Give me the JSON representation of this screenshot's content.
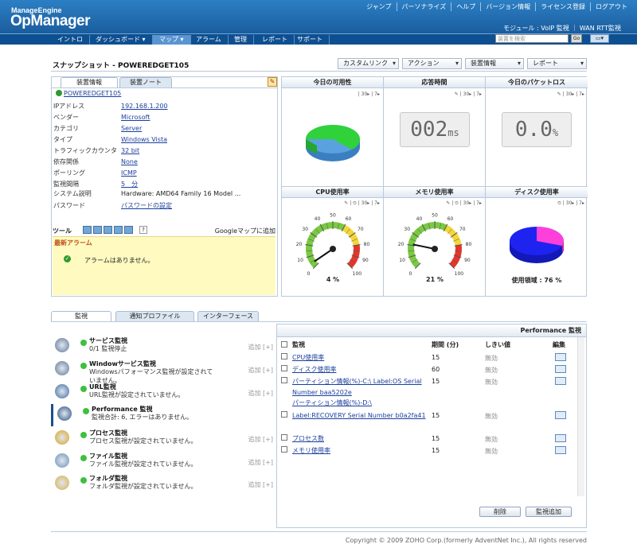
{
  "header": {
    "brand_small": "ManageEngine",
    "brand_large": "OpManager",
    "top_links": [
      "ジャンプ",
      "パーソナライズ",
      "ヘルプ",
      "バージョン情報",
      "ライセンス登録",
      "ログアウト"
    ],
    "module_line": "モジュール : VoIP 監視 ｜ WAN RTT監視",
    "search_placeholder": "装置を検索",
    "go_label": "Go"
  },
  "nav": {
    "tabs": [
      "イントロ",
      "ダッシュボード ▾",
      "マップ ▾",
      "アラーム",
      "管理",
      "レポート",
      "サポート"
    ],
    "active": "マップ ▾"
  },
  "snapshot": {
    "title": "スナップショット - POWEREDGET105",
    "dropdowns": [
      "カスタムリンク",
      "アクション",
      "装置情報",
      "レポート"
    ]
  },
  "device": {
    "tabs": [
      "装置情報",
      "装置ノート"
    ],
    "name": "POWEREDGET105",
    "props": [
      {
        "k": "IPアドレス",
        "v": "192.168.1.200",
        "link": true
      },
      {
        "k": "ベンダー",
        "v": "Microsoft",
        "link": true
      },
      {
        "k": "カテゴリ",
        "v": "Server",
        "link": true
      },
      {
        "k": "タイプ",
        "v": "Windows Vista",
        "link": true
      },
      {
        "k": "トラフィックカウンタ",
        "v": "32 bit",
        "link": true
      },
      {
        "k": "依存関係",
        "v": "None",
        "link": true
      },
      {
        "k": "ポーリング",
        "v": "ICMP",
        "link": true
      },
      {
        "k": "監視間隔",
        "v": "5　分",
        "link": true
      },
      {
        "k": "システム説明",
        "v": "Hardware: AMD64 Family 16 Model ...",
        "link": false
      },
      {
        "k": "パスワード",
        "v": "パスワードの設定",
        "link": true
      }
    ],
    "tools_label": "ツール",
    "google_map": "Googleマップに追加",
    "alarm_title": "最新アラーム",
    "alarm_msg": "アラームはありません。"
  },
  "dash": {
    "availability_title": "今日の可用性",
    "response_title": "応答時間",
    "response_value": "002",
    "response_unit": "ms",
    "loss_title": "今日のパケットロス",
    "loss_value": "0.0",
    "loss_unit": "%",
    "cpu_title": "CPU使用率",
    "cpu_value": "4 %",
    "cpu_level": 4,
    "mem_title": "メモリ使用率",
    "mem_value": "21 %",
    "mem_level": 21,
    "disk_title": "ディスク使用率",
    "disk_label": "使用領域 : 76 %",
    "disk_level": 76,
    "tool_30": "30",
    "tool_7": "7",
    "gauge_ticks": [
      "0",
      "10",
      "20",
      "30",
      "40",
      "50",
      "60",
      "70",
      "80",
      "90",
      "100"
    ],
    "colors": {
      "green": "#2fd23a",
      "blue": "#5aa2df",
      "disk_used": "#1f23f0",
      "disk_free": "#ff3fd9"
    }
  },
  "monitors": {
    "tabs": [
      "監視",
      "通知プロファイル",
      "インターフェース"
    ],
    "items": [
      {
        "title": "サービス監視",
        "desc": "0/1 監視停止",
        "add": "追加 [+]"
      },
      {
        "title": "Windowサービス監視",
        "desc": "Windowsパフォーマンス監視が設定されていません。",
        "add": "追加 [+]"
      },
      {
        "title": "URL監視",
        "desc": "URL監視が設定されていません。",
        "add": "追加 [+]"
      },
      {
        "title": "Performance 監視",
        "desc": "監視合計: 6, エラーはありません。",
        "add": ""
      },
      {
        "title": "プロセス監視",
        "desc": "プロセス監視が設定されていません。",
        "add": "追加 [+]"
      },
      {
        "title": "ファイル監視",
        "desc": "ファイル監視が設定されていません。",
        "add": "追加 [+]"
      },
      {
        "title": "フォルダ監視",
        "desc": "フォルダ監視が設定されていません。",
        "add": "追加 [+]"
      }
    ],
    "right_title": "Performance 監視",
    "columns": [
      "監視",
      "期間 (分)",
      "しきい値",
      "編集"
    ],
    "rows": [
      {
        "name": "CPU使用率",
        "period": "15",
        "thr": "無効"
      },
      {
        "name": "ディスク使用率",
        "period": "60",
        "thr": "無効"
      },
      {
        "name": "パーティション情報(%)-C:\\ Label:OS Serial Number baa5202e",
        "period": "15",
        "thr": "無効",
        "extra": "パーティション情報(%)-D:\\"
      },
      {
        "name": "Label:RECOVERY Serial Number b0a2fa41",
        "period": "15",
        "thr": "無効"
      },
      {
        "name": "プロセス数",
        "period": "15",
        "thr": "無効"
      },
      {
        "name": "メモリ使用率",
        "period": "15",
        "thr": "無効"
      }
    ],
    "delete_btn": "削除",
    "add_btn": "監視追加"
  },
  "footer": "Copyright © 2009 ZOHO Corp.(formerly AdventNet Inc.), All rights reserved"
}
